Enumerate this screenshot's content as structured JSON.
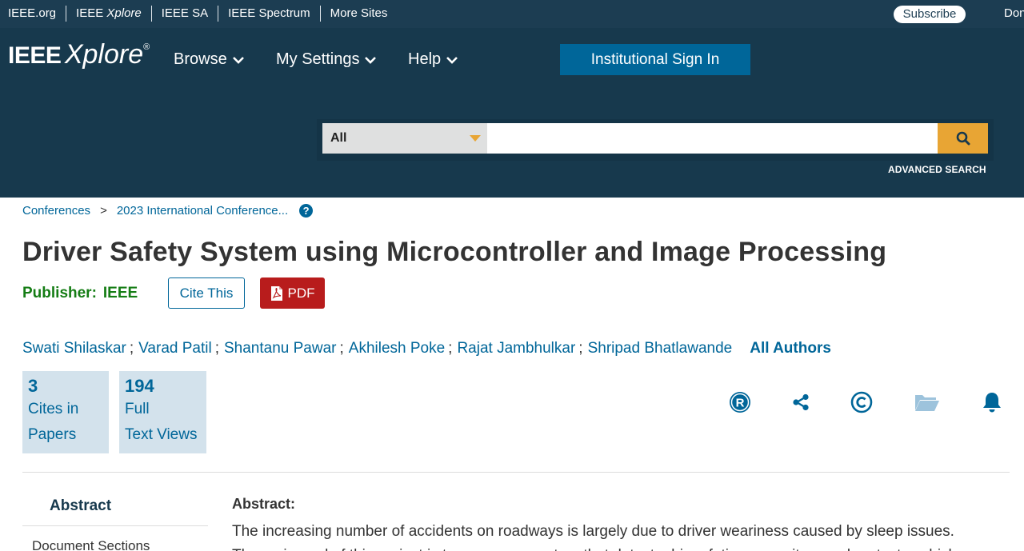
{
  "topbar": {
    "links": [
      {
        "label": "IEEE.org"
      },
      {
        "label_plain": "IEEE ",
        "label_italic": "Xplore"
      },
      {
        "label": "IEEE SA"
      },
      {
        "label": "IEEE Spectrum"
      },
      {
        "label": "More Sites"
      }
    ],
    "subscribe": "Subscribe",
    "donate": "Donate"
  },
  "header": {
    "logo_ieee": "IEEE",
    "logo_xplore": "Xplore",
    "logo_reg": "®",
    "nav": [
      "Browse",
      "My Settings",
      "Help"
    ],
    "signin": "Institutional Sign In"
  },
  "search": {
    "scope": "All",
    "input_value": "",
    "placeholder": "",
    "advanced": "ADVANCED SEARCH"
  },
  "breadcrumb": {
    "items": [
      "Conferences",
      "2023 International Conference..."
    ],
    "separator": ">",
    "help_glyph": "?"
  },
  "article": {
    "title": "Driver Safety System using Microcontroller and Image Processing",
    "publisher_label": "Publisher:",
    "publisher_value": "IEEE",
    "cite_label": "Cite This",
    "pdf_label": "PDF",
    "authors": [
      "Swati Shilaskar",
      "Varad Patil",
      "Shantanu Pawar",
      "Akhilesh Poke",
      "Rajat Jambhulkar",
      "Shripad Bhatlawande"
    ],
    "author_separator": ";",
    "all_authors": "All Authors"
  },
  "metrics": [
    {
      "number": "3",
      "line1": "Cites in",
      "line2": "Papers"
    },
    {
      "number": "194",
      "line1": "Full",
      "line2": "Text Views"
    }
  ],
  "action_icons": [
    "rights-icon",
    "share-icon",
    "copyright-icon",
    "folder-icon",
    "bell-icon"
  ],
  "sidebar": {
    "abstract": "Abstract",
    "document_sections": "Document Sections"
  },
  "abstract": {
    "heading": "Abstract:",
    "text": "The increasing number of accidents on roadways is largely due to driver weariness caused by sleep issues. The main goal of this project is to propose a system that detects driver fatigue, monitors and protects vehicle"
  },
  "colors": {
    "topbar": "#1c3d52",
    "header": "#17394d",
    "link": "#006699",
    "accent": "#e8a534",
    "publisher": "#157d15",
    "pdf": "#b81c1c",
    "metric_bg": "#d3e2ec"
  }
}
